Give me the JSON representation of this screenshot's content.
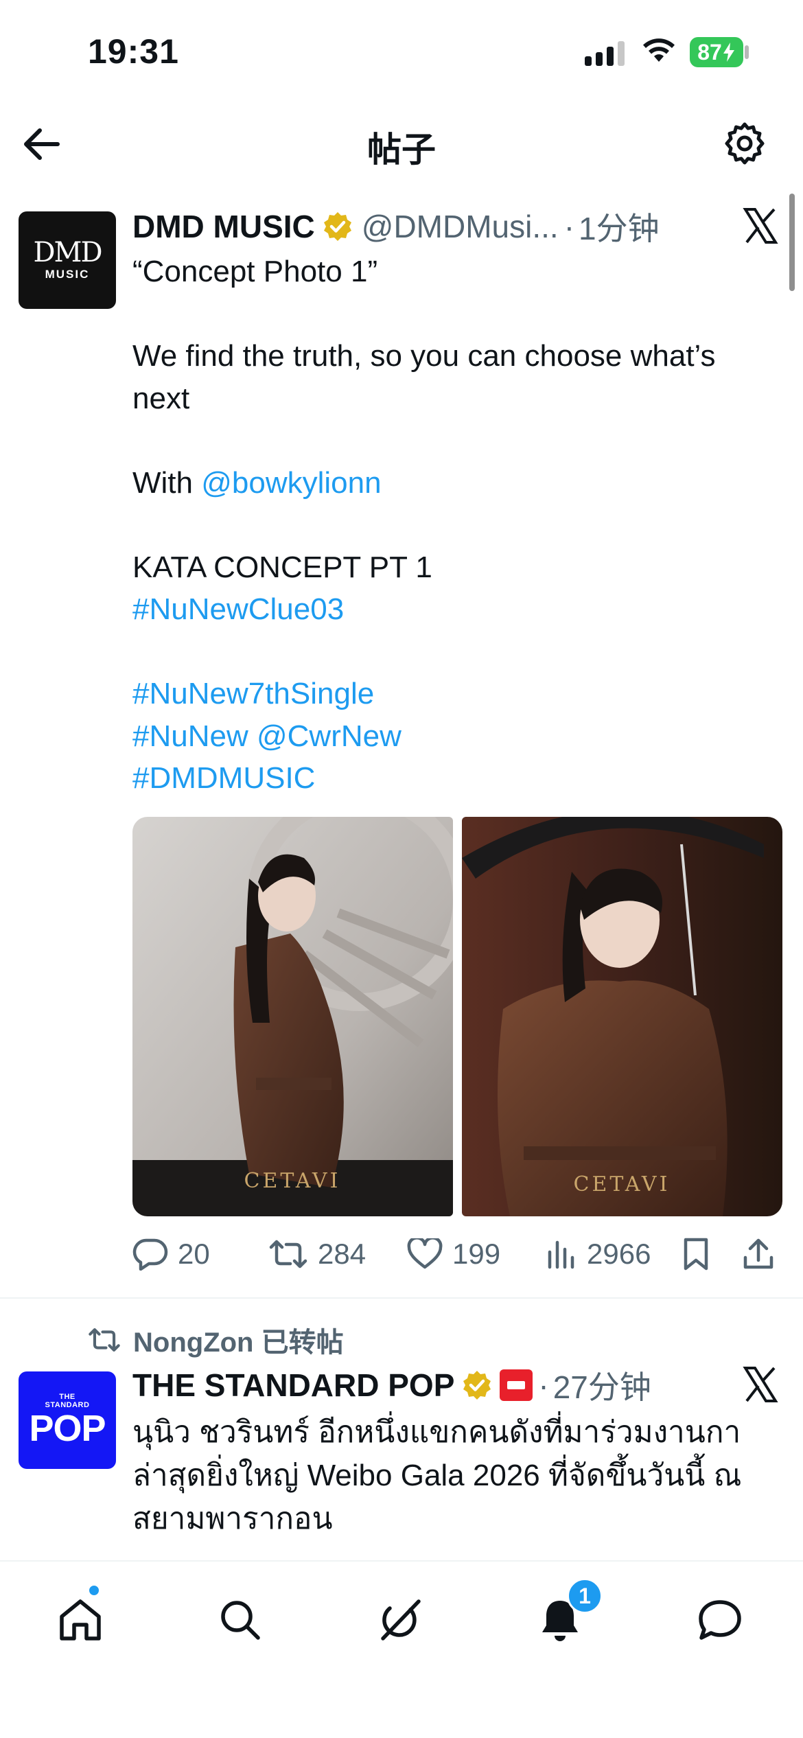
{
  "status_bar": {
    "time": "19:31",
    "battery": "87"
  },
  "header": {
    "title": "帖子"
  },
  "post": {
    "display_name": "DMD MUSIC",
    "handle": "@DMDMusi...",
    "dot": "·",
    "time": "1分钟",
    "avatar_text": {
      "line1": "DMD",
      "line2": "MUSIC"
    },
    "lines": {
      "l1": "“Concept Photo 1”",
      "l2": "We find the truth, so you can choose what’s",
      "l3": "next",
      "l4_prefix": "With ",
      "l4_mention": "@bowkylionn",
      "l5": "KATA CONCEPT PT 1",
      "l6": "#NuNewClue03",
      "l7": "#NuNew7thSingle",
      "l8_tag": "#NuNew",
      "l8_space": " ",
      "l8_mention": "@CwrNew",
      "l9": "#DMDMUSIC"
    },
    "actions": {
      "replies": "20",
      "reposts": "284",
      "likes": "199",
      "views": "2966"
    }
  },
  "second_post": {
    "repost_note": "NongZon 已转帖",
    "display_name": "THE STANDARD POP",
    "dot": "·",
    "time": "27分钟",
    "avatar_text": {
      "tag_line1": "THE",
      "tag_line2": "STANDARD",
      "main": "POP"
    },
    "text": "นุนิว ชวรินทร์ อีกหนึ่งแขกคนดังที่มาร่วมงานกาล่าสุดยิ่งใหญ่ Weibo Gala 2026 ที่จัดขึ้นวันนี้ ณ สยามพารากอน"
  },
  "tab_bar": {
    "notifications_badge": "1"
  },
  "colors": {
    "accent": "#1d9bf0",
    "text": "#0f1419",
    "muted": "#536471",
    "battery": "#34c759"
  }
}
